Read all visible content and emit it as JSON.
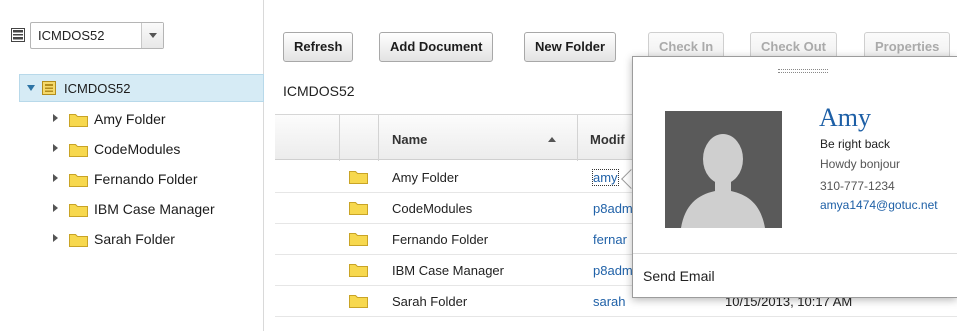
{
  "repository": {
    "selected": "ICMDOS52"
  },
  "tree": {
    "root_label": "ICMDOS52",
    "items": [
      {
        "label": "Amy Folder"
      },
      {
        "label": "CodeModules"
      },
      {
        "label": "Fernando Folder"
      },
      {
        "label": "IBM Case Manager"
      },
      {
        "label": "Sarah Folder"
      }
    ]
  },
  "toolbar": {
    "refresh": "Refresh",
    "add_document": "Add Document",
    "new_folder": "New Folder",
    "check_in": "Check In",
    "check_out": "Check Out",
    "properties": "Properties"
  },
  "breadcrumb": "ICMDOS52",
  "grid": {
    "columns": {
      "name": "Name",
      "modified_by": "Modif"
    },
    "rows": [
      {
        "name": "Amy Folder",
        "user": "amy",
        "date": ""
      },
      {
        "name": "CodeModules",
        "user": "p8adm",
        "date": ""
      },
      {
        "name": "Fernando Folder",
        "user": "fernar",
        "date": ""
      },
      {
        "name": "IBM Case Manager",
        "user": "p8adm",
        "date": ""
      },
      {
        "name": "Sarah Folder",
        "user": "sarah",
        "date": "10/15/2013, 10:17 AM"
      }
    ]
  },
  "business_card": {
    "name": "Amy",
    "status": "Be right back",
    "message": "Howdy bonjour",
    "phone": "310-777-1234",
    "email": "amya1474@gotuc.net",
    "action": "Send Email"
  },
  "colors": {
    "selection_bg": "#d6ebf5",
    "link": "#2162a8",
    "folder": "#f7d84e"
  }
}
